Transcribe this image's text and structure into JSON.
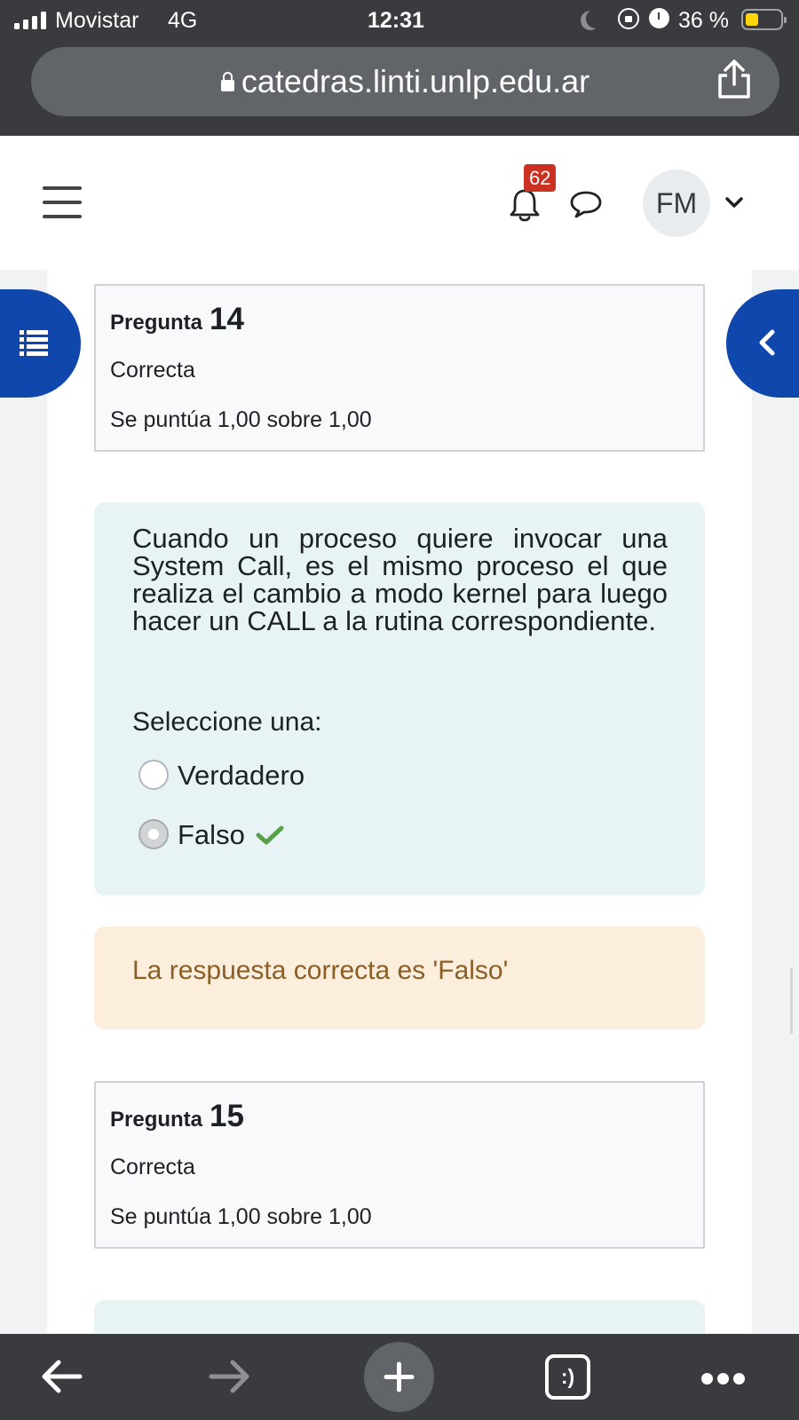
{
  "status_bar": {
    "carrier": "Movistar",
    "network": "4G",
    "time": "12:31",
    "battery_percent": "36 %",
    "battery_level": 0.36,
    "icons": [
      "signal-bars-icon",
      "moon-icon",
      "orientation-lock-icon",
      "alarm-icon",
      "battery-icon"
    ]
  },
  "browser": {
    "url": "catedras.linti.unlp.edu.ar",
    "icons": [
      "lock-icon",
      "share-icon",
      "back-arrow-icon",
      "forward-arrow-icon",
      "plus-icon",
      "tabs-icon",
      "more-icon"
    ],
    "tabs_label": ":)"
  },
  "navbar": {
    "notification_count": "62",
    "user_initials": "FM",
    "icons": [
      "hamburger-icon",
      "bell-icon",
      "chat-icon",
      "chevron-down-icon"
    ]
  },
  "drawers": {
    "icons": [
      "list-icon",
      "chevron-left-icon"
    ]
  },
  "questions": [
    {
      "label": "Pregunta",
      "number": "14",
      "state": "Correcta",
      "grade": "Se puntúa 1,00 sobre 1,00",
      "text": "Cuando un proceso quiere invocar una System Call, es el mismo proceso el que realiza el cambio a  modo kernel para luego hacer un CALL a la rutina correspondiente.",
      "prompt": "Seleccione una:",
      "options": [
        {
          "label": "Verdadero",
          "selected": false
        },
        {
          "label": "Falso",
          "selected": true,
          "correct": true
        }
      ],
      "feedback": "La respuesta correcta es 'Falso'"
    },
    {
      "label": "Pregunta",
      "number": "15",
      "state": "Correcta",
      "grade": "Se puntúa 1,00 sobre 1,00"
    }
  ],
  "colors": {
    "drawer_blue": "#0f47ad",
    "badge_red": "#ca3120",
    "formulation_bg": "#e7f3f5",
    "feedback_bg": "#fbeedd",
    "feedback_text": "#8a5e25",
    "tick_green": "#5ba14b"
  }
}
